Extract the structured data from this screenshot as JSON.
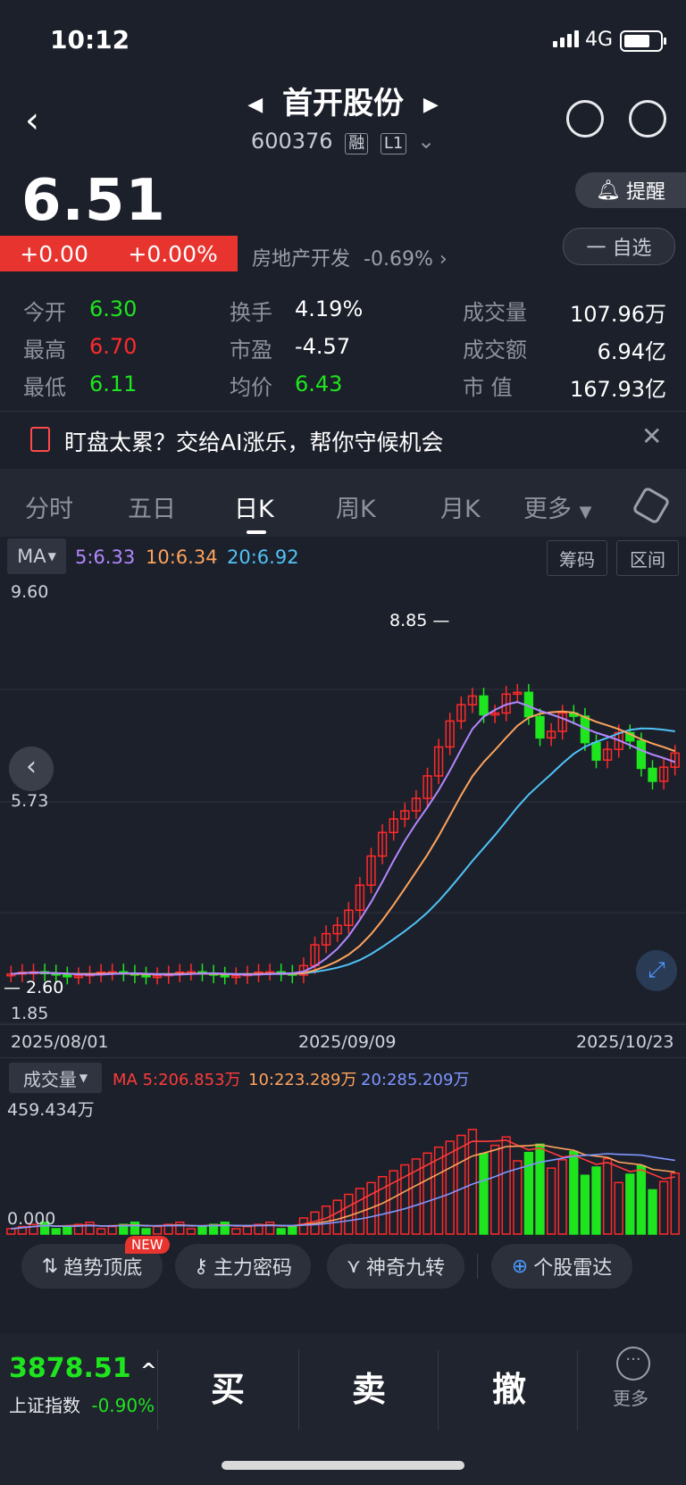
{
  "status": {
    "time": "10:12",
    "network": "4G"
  },
  "header": {
    "title": "首开股份",
    "code": "600376",
    "tag1": "融",
    "tag2": "L1"
  },
  "quote": {
    "price": "6.51",
    "change": "+0.00",
    "change_pct": "+0.00%",
    "sector": "房地产开发",
    "sector_pct": "-0.69%",
    "remind": "提醒",
    "watch": "一 自选",
    "rows": [
      {
        "l1": "今开",
        "v1": "6.30",
        "l2": "换手",
        "v2": "4.19%",
        "l3": "成交量",
        "v3": "107.96万"
      },
      {
        "l1": "最高",
        "v1": "6.70",
        "l2": "市盈",
        "v2": "-4.57",
        "l3": "成交额",
        "v3": "6.94亿"
      },
      {
        "l1": "最低",
        "v1": "6.11",
        "l2": "均价",
        "v2": "6.43",
        "l3": "市  值",
        "v3": "167.93亿"
      }
    ]
  },
  "banner": {
    "text": "盯盘太累？交给AI涨乐，帮你守候机会"
  },
  "tabs": [
    "分时",
    "五日",
    "日K",
    "周K",
    "月K",
    "更多"
  ],
  "ma": {
    "label": "MA",
    "ma5": "5:6.33",
    "ma10": "10:6.34",
    "ma20": "20:6.92",
    "btn_chip": "筹码",
    "btn_range": "区间"
  },
  "price_axis": {
    "top": "9.60",
    "mid": "5.73",
    "bottom": "1.85",
    "high_mark": "8.85",
    "low_mark": "2.60"
  },
  "dates": [
    "2025/08/01",
    "2025/09/09",
    "2025/10/23"
  ],
  "volume": {
    "label": "成交量",
    "ma5": "MA 5:206.853万",
    "ma10": "10:223.289万",
    "ma20": "20:285.209万",
    "max": "459.434万",
    "zero": "0.000"
  },
  "tools": [
    "趋势顶底",
    "主力密码",
    "神奇九转",
    "个股雷达"
  ],
  "new_badge": "NEW",
  "footer": {
    "index_value": "3878.51",
    "index_name": "上证指数",
    "index_pct": "-0.90%",
    "buy": "买",
    "sell": "卖",
    "cancel": "撤",
    "more": "更多"
  },
  "colors": {
    "up": "#ff2a2a",
    "down": "#1ee51e",
    "ma5": "#b388ff",
    "ma10": "#ffa35c",
    "ma20": "#4fc3f7",
    "bg": "#1c202b"
  },
  "chart_data": {
    "type": "candlestick",
    "price_ylim": [
      1.85,
      9.6
    ],
    "x_labels": [
      "2025/08/01",
      "2025/09/09",
      "2025/10/23"
    ],
    "ma_series": [
      {
        "name": "MA5",
        "value": 6.33
      },
      {
        "name": "MA10",
        "value": 6.34
      },
      {
        "name": "MA20",
        "value": 6.92
      }
    ],
    "volume_ylim": [
      0,
      459.434
    ],
    "volume_ma": [
      {
        "name": "MA5",
        "value": 206.853
      },
      {
        "name": "MA10",
        "value": 223.289
      },
      {
        "name": "MA20",
        "value": 285.209
      }
    ]
  }
}
